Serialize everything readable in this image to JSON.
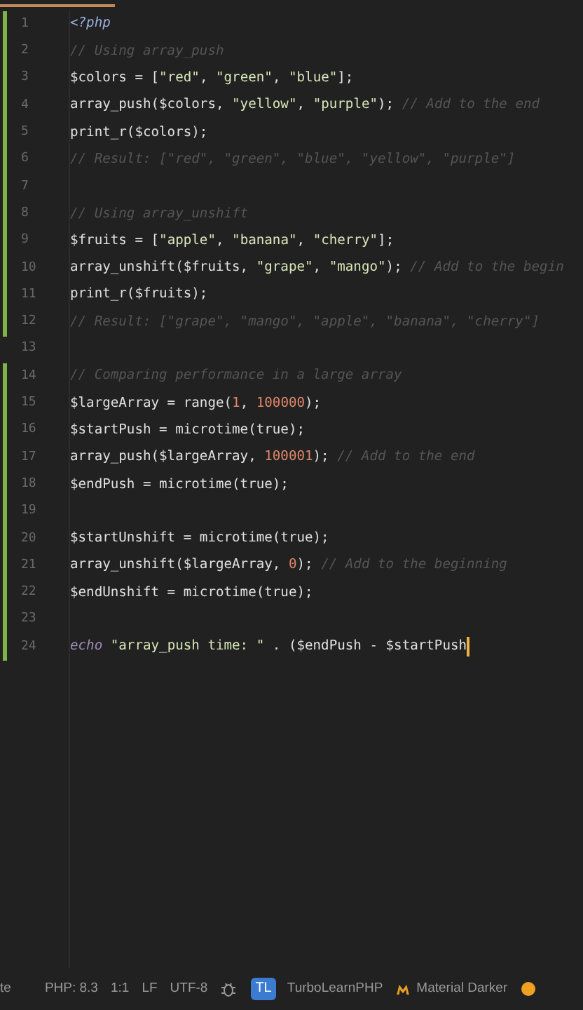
{
  "lines": [
    {
      "number": "1",
      "changed": true,
      "caret": false,
      "tokens": [
        {
          "kind": "tag",
          "text": "<?php"
        }
      ]
    },
    {
      "number": "2",
      "changed": true,
      "caret": false,
      "tokens": [
        {
          "kind": "comment",
          "text": "// Using array_push"
        }
      ]
    },
    {
      "number": "3",
      "changed": true,
      "caret": false,
      "tokens": [
        {
          "kind": "code",
          "text": "$colors = ["
        },
        {
          "kind": "string",
          "text": "\"red\""
        },
        {
          "kind": "code",
          "text": ", "
        },
        {
          "kind": "string",
          "text": "\"green\""
        },
        {
          "kind": "code",
          "text": ", "
        },
        {
          "kind": "string",
          "text": "\"blue\""
        },
        {
          "kind": "code",
          "text": "];"
        }
      ]
    },
    {
      "number": "4",
      "changed": true,
      "caret": false,
      "tokens": [
        {
          "kind": "code",
          "text": "array_push($colors, "
        },
        {
          "kind": "string",
          "text": "\"yellow\""
        },
        {
          "kind": "code",
          "text": ", "
        },
        {
          "kind": "string",
          "text": "\"purple\""
        },
        {
          "kind": "code",
          "text": "); "
        },
        {
          "kind": "comment",
          "text": "// Add to the end"
        }
      ]
    },
    {
      "number": "5",
      "changed": true,
      "caret": false,
      "tokens": [
        {
          "kind": "code",
          "text": "print_r($colors);"
        }
      ]
    },
    {
      "number": "6",
      "changed": true,
      "caret": false,
      "tokens": [
        {
          "kind": "comment",
          "text": "// Result: [\"red\", \"green\", \"blue\", \"yellow\", \"purple\"]"
        }
      ]
    },
    {
      "number": "7",
      "changed": true,
      "caret": false
    },
    {
      "number": "8",
      "changed": true,
      "caret": false,
      "tokens": [
        {
          "kind": "comment",
          "text": "// Using array_unshift"
        }
      ]
    },
    {
      "number": "9",
      "changed": true,
      "caret": false,
      "tokens": [
        {
          "kind": "code",
          "text": "$fruits = ["
        },
        {
          "kind": "string",
          "text": "\"apple\""
        },
        {
          "kind": "code",
          "text": ", "
        },
        {
          "kind": "string",
          "text": "\"banana\""
        },
        {
          "kind": "code",
          "text": ", "
        },
        {
          "kind": "string",
          "text": "\"cherry\""
        },
        {
          "kind": "code",
          "text": "];"
        }
      ]
    },
    {
      "number": "10",
      "changed": true,
      "caret": false,
      "tokens": [
        {
          "kind": "code",
          "text": "array_unshift($fruits, "
        },
        {
          "kind": "string",
          "text": "\"grape\""
        },
        {
          "kind": "code",
          "text": ", "
        },
        {
          "kind": "string",
          "text": "\"mango\""
        },
        {
          "kind": "code",
          "text": "); "
        },
        {
          "kind": "comment",
          "text": "// Add to the begin"
        }
      ]
    },
    {
      "number": "11",
      "changed": true,
      "caret": false,
      "tokens": [
        {
          "kind": "code",
          "text": "print_r($fruits);"
        }
      ]
    },
    {
      "number": "12",
      "changed": true,
      "caret": false,
      "tokens": [
        {
          "kind": "comment",
          "text": "// Result: [\"grape\", \"mango\", \"apple\", \"banana\", \"cherry\"]"
        }
      ]
    },
    {
      "number": "13",
      "changed": false,
      "caret": false
    },
    {
      "number": "14",
      "changed": true,
      "caret": false,
      "tokens": [
        {
          "kind": "comment",
          "text": "// Comparing performance in a large array"
        }
      ]
    },
    {
      "number": "15",
      "changed": true,
      "caret": false,
      "tokens": [
        {
          "kind": "code",
          "text": "$largeArray = range("
        },
        {
          "kind": "number",
          "text": "1"
        },
        {
          "kind": "code",
          "text": ", "
        },
        {
          "kind": "number",
          "text": "100000"
        },
        {
          "kind": "code",
          "text": ");"
        }
      ]
    },
    {
      "number": "16",
      "changed": true,
      "caret": false,
      "tokens": [
        {
          "kind": "code",
          "text": "$startPush = microtime(true);"
        }
      ]
    },
    {
      "number": "17",
      "changed": true,
      "caret": false,
      "tokens": [
        {
          "kind": "code",
          "text": "array_push($largeArray, "
        },
        {
          "kind": "number",
          "text": "100001"
        },
        {
          "kind": "code",
          "text": "); "
        },
        {
          "kind": "comment",
          "text": "// Add to the end"
        }
      ]
    },
    {
      "number": "18",
      "changed": true,
      "caret": false,
      "tokens": [
        {
          "kind": "code",
          "text": "$endPush = microtime(true);"
        }
      ]
    },
    {
      "number": "19",
      "changed": true,
      "caret": false
    },
    {
      "number": "20",
      "changed": true,
      "caret": false,
      "tokens": [
        {
          "kind": "code",
          "text": "$startUnshift = microtime(true);"
        }
      ]
    },
    {
      "number": "21",
      "changed": true,
      "caret": false,
      "tokens": [
        {
          "kind": "code",
          "text": "array_unshift($largeArray, "
        },
        {
          "kind": "number",
          "text": "0"
        },
        {
          "kind": "code",
          "text": "); "
        },
        {
          "kind": "comment",
          "text": "// Add to the beginning"
        }
      ]
    },
    {
      "number": "22",
      "changed": true,
      "caret": false,
      "tokens": [
        {
          "kind": "code",
          "text": "$endUnshift = microtime(true);"
        }
      ]
    },
    {
      "number": "23",
      "changed": true,
      "caret": false
    },
    {
      "number": "24",
      "changed": true,
      "caret": true,
      "tokens": [
        {
          "kind": "keyword",
          "text": "echo"
        },
        {
          "kind": "string",
          "text": " \"array_push time: \" "
        },
        {
          "kind": "code",
          "text": ". ($endPush - $startPush"
        }
      ]
    }
  ],
  "status_bar": {
    "cut_item": "te",
    "language": "PHP: 8.3",
    "position": "1:1",
    "line_ending": "LF",
    "encoding": "UTF-8",
    "project_badge": "TL",
    "project": "TurboLearnPHP",
    "theme": "Material Darker"
  }
}
